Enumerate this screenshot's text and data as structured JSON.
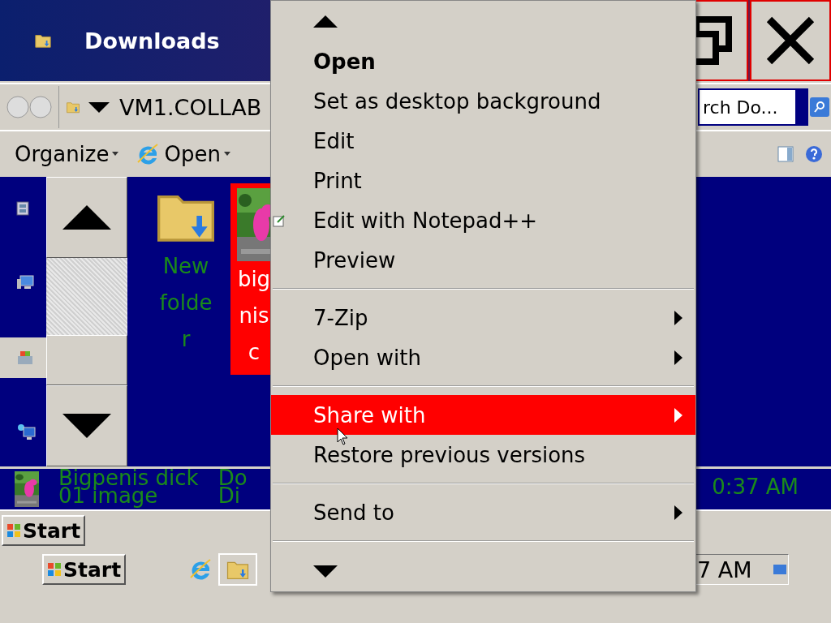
{
  "window": {
    "title": "Downloads"
  },
  "address_bar": {
    "path": "VM1.COLLAB"
  },
  "search": {
    "value": "rch Do..."
  },
  "toolbar": [
    {
      "label": "Organize",
      "kind": "plain"
    },
    {
      "label": "Open",
      "kind": "browser"
    }
  ],
  "navigation": [
    {
      "kind": "video",
      "selected": false
    },
    {
      "kind": "computer",
      "selected": false
    },
    {
      "kind": "libraries",
      "selected": true
    },
    {
      "kind": "network",
      "selected": false
    }
  ],
  "files": [
    {
      "kind": "folder",
      "name_lines": [
        "New",
        "folde",
        "r"
      ],
      "selected": false
    },
    {
      "name_lines": [
        "big",
        "nis",
        "c"
      ],
      "selected": true
    }
  ],
  "details_row": {
    "name_lines": [
      "Bigpenis dick",
      "01 image"
    ],
    "column_3": [
      "Do",
      "Di"
    ],
    "column_4": "0:37 AM"
  },
  "taskbar": {
    "start_buttons": [
      "Start",
      "Start"
    ],
    "clock": "7 AM"
  },
  "context_menu": {
    "items": [
      {
        "kind": "item",
        "label": "Open",
        "default": true,
        "submenu": false,
        "selected": false
      },
      {
        "kind": "item",
        "label": "Set as desktop background",
        "default": false,
        "submenu": false,
        "selected": false
      },
      {
        "kind": "item",
        "label": "Edit",
        "default": false,
        "submenu": false,
        "selected": false
      },
      {
        "kind": "item",
        "label": "Print",
        "default": false,
        "submenu": false,
        "selected": false
      },
      {
        "kind": "item",
        "label": "Edit with Notepad++",
        "icon": true,
        "default": false,
        "submenu": false,
        "selected": false
      },
      {
        "kind": "item",
        "label": "Preview",
        "default": false,
        "submenu": false,
        "selected": false
      },
      {
        "kind": "separator"
      },
      {
        "kind": "item",
        "label": "7-Zip",
        "default": false,
        "submenu": true,
        "selected": false
      },
      {
        "kind": "item",
        "label": "Open with",
        "default": false,
        "submenu": true,
        "selected": false
      },
      {
        "kind": "separator"
      },
      {
        "kind": "item",
        "label": "Share with",
        "default": false,
        "submenu": true,
        "selected": true
      },
      {
        "kind": "item",
        "label": "Restore previous versions",
        "default": false,
        "submenu": false,
        "selected": false
      },
      {
        "kind": "separator"
      },
      {
        "kind": "item",
        "label": "Send to",
        "default": false,
        "submenu": true,
        "selected": false
      },
      {
        "kind": "separator"
      }
    ]
  }
}
